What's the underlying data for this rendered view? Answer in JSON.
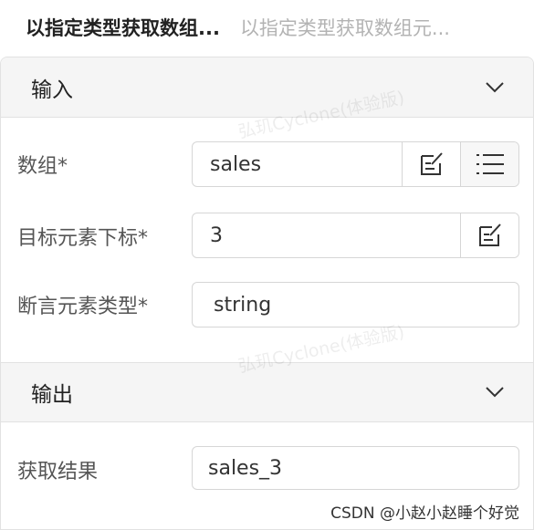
{
  "tabs": [
    {
      "label": "以指定类型获取数组..."
    },
    {
      "label": "以指定类型获取数组元..."
    }
  ],
  "input_section": {
    "title": "输入",
    "fields": [
      {
        "label": "数组*",
        "value": "sales"
      },
      {
        "label": "目标元素下标*",
        "value": "3"
      },
      {
        "label": "断言元素类型*",
        "value": "string"
      }
    ]
  },
  "output_section": {
    "title": "输出",
    "fields": [
      {
        "label": "获取结果",
        "value": "sales_3"
      }
    ]
  },
  "watermark": "弘玑Cyclone(体验版)",
  "credit": "CSDN @小赵小赵睡个好觉",
  "icons": [
    "edit-icon",
    "list-icon",
    "chevron-down-icon"
  ]
}
